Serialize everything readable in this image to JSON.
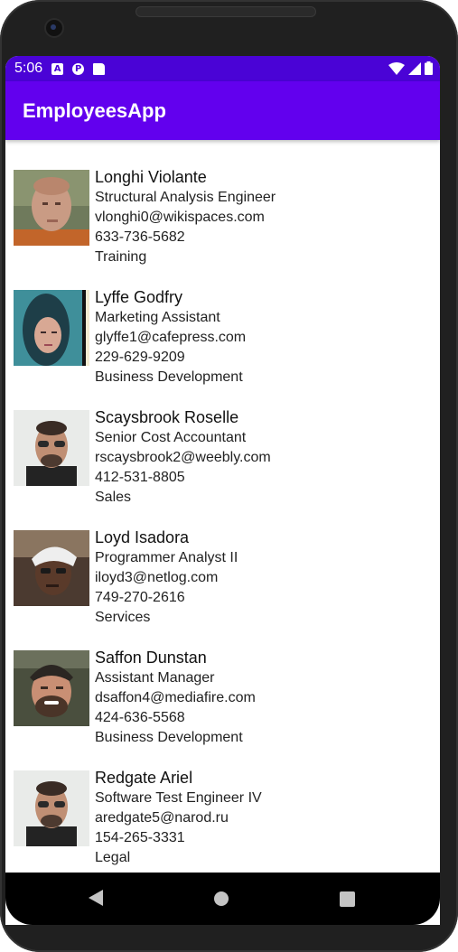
{
  "status_bar": {
    "time": "5:06",
    "icons": [
      "a-icon",
      "p-icon",
      "sd-card-icon",
      "wifi-icon",
      "signal-icon",
      "battery-icon"
    ]
  },
  "app_bar": {
    "title": "EmployeesApp"
  },
  "colors": {
    "status_bar": "#4a03d6",
    "app_bar": "#6200ee",
    "nav_bar": "#000000"
  },
  "employees": [
    {
      "name": "Longhi Violante",
      "title": "Structural Analysis Engineer",
      "email": "vlonghi0@wikispaces.com",
      "phone": "633-736-5682",
      "department": "Training"
    },
    {
      "name": "Lyffe Godfry",
      "title": "Marketing Assistant",
      "email": "glyffe1@cafepress.com",
      "phone": "229-629-9209",
      "department": "Business Development"
    },
    {
      "name": "Scaysbrook Roselle",
      "title": "Senior Cost Accountant",
      "email": "rscaysbrook2@weebly.com",
      "phone": "412-531-8805",
      "department": "Sales"
    },
    {
      "name": "Loyd Isadora",
      "title": "Programmer Analyst II",
      "email": "iloyd3@netlog.com",
      "phone": "749-270-2616",
      "department": "Services"
    },
    {
      "name": "Saffon Dunstan",
      "title": "Assistant Manager",
      "email": "dsaffon4@mediafire.com",
      "phone": "424-636-5568",
      "department": "Business Development"
    },
    {
      "name": "Redgate Ariel",
      "title": "Software Test Engineer IV",
      "email": "aredgate5@narod.ru",
      "phone": "154-265-3331",
      "department": "Legal"
    }
  ],
  "nav_bar": {
    "icons": [
      "back-icon",
      "home-icon",
      "recents-icon"
    ]
  }
}
